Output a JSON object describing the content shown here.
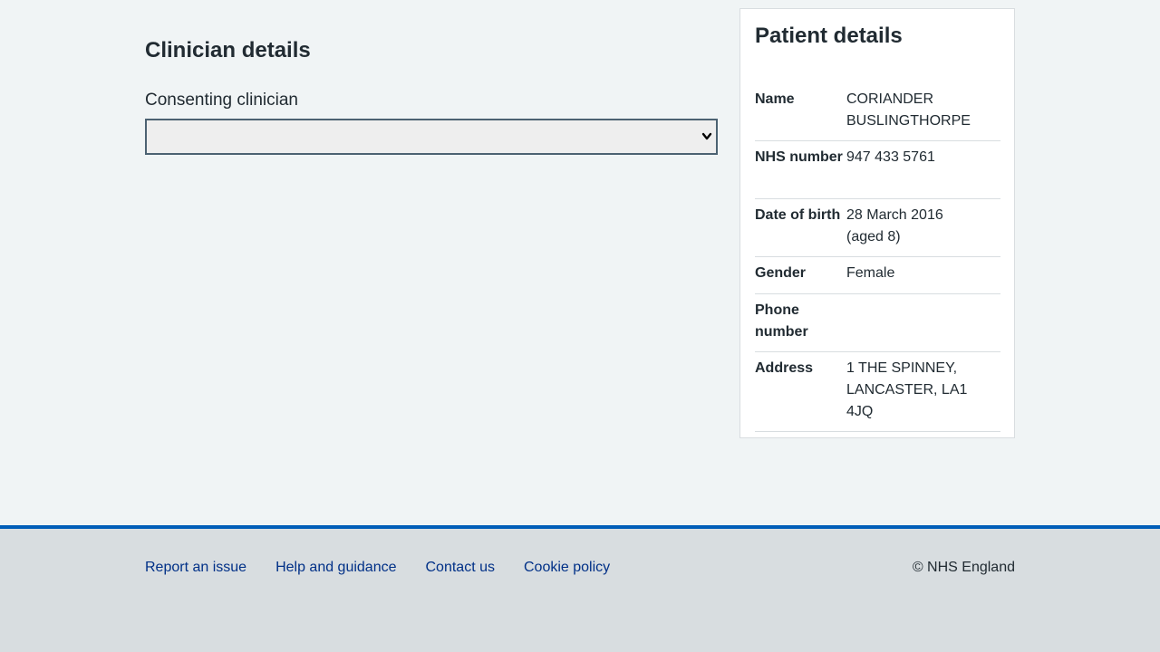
{
  "clinician": {
    "title": "Clinician details",
    "field_label": "Consenting clinician",
    "select_value": ""
  },
  "patient": {
    "title": "Patient details",
    "rows": [
      {
        "key": "Name",
        "value": "CORIANDER BUSLINGTHORPE"
      },
      {
        "key": "NHS number",
        "value": "947 433 5761"
      },
      {
        "key": "Date of birth",
        "value": "28 March 2016 (aged 8)"
      },
      {
        "key": "Gender",
        "value": "Female"
      },
      {
        "key": "Phone number",
        "value": ""
      },
      {
        "key": "Address",
        "value": "1 THE SPINNEY, LANCASTER, LA1 4JQ"
      }
    ]
  },
  "footer": {
    "links": [
      "Report an issue",
      "Help and guidance",
      "Contact us",
      "Cookie policy"
    ],
    "copyright": "© NHS England"
  },
  "colors": {
    "background": "#f0f4f5",
    "footer_bg": "#d8dde0",
    "footer_border": "#005eb8",
    "link": "#003087"
  },
  "icons": {
    "select": "chevron-down-icon"
  }
}
